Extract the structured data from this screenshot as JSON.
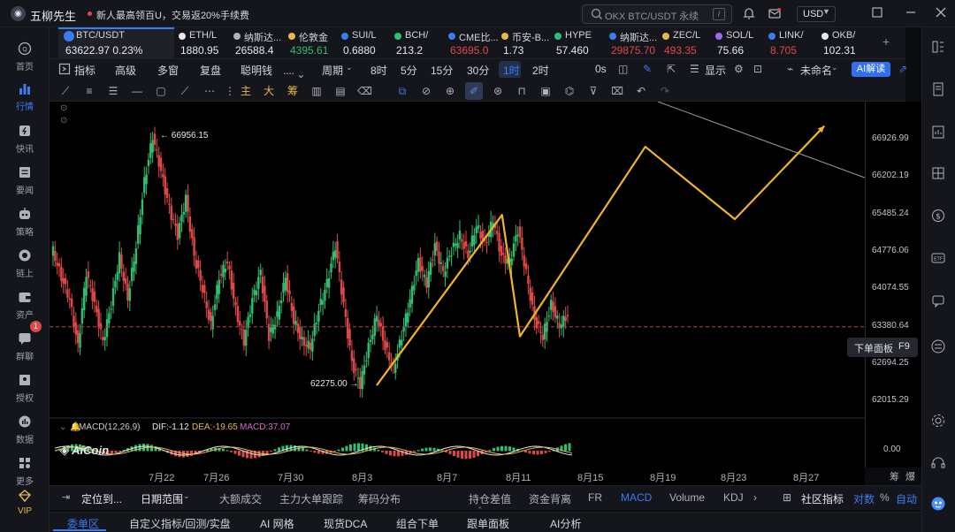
{
  "app": {
    "name": "五柳先生",
    "notice": "新人最高领百U，交易返20%手续费",
    "search_placeholder": "OKX BTC/USDT 永续",
    "search_key": "/",
    "currency": "USD"
  },
  "nav": [
    {
      "label": "首页",
      "icon": "home-icon"
    },
    {
      "label": "行情",
      "icon": "market-chart-icon",
      "active": true
    },
    {
      "label": "快讯",
      "icon": "news-flash-icon"
    },
    {
      "label": "要闻",
      "icon": "headline-icon"
    },
    {
      "label": "策略",
      "icon": "robot-icon"
    },
    {
      "label": "链上",
      "icon": "onchain-icon"
    },
    {
      "label": "资产",
      "icon": "wallet-icon"
    },
    {
      "label": "群聊",
      "icon": "chat-icon",
      "badge": "1"
    },
    {
      "label": "授权",
      "icon": "auth-icon"
    },
    {
      "label": "数据",
      "icon": "data-icon"
    },
    {
      "label": "更多",
      "icon": "more-icon"
    },
    {
      "label": "VIP",
      "icon": "vip-diamond-icon"
    }
  ],
  "tickers": [
    {
      "name": "BTC/USDT",
      "price": "63622.97",
      "change": "0.23%",
      "color": "white",
      "active": true
    },
    {
      "name": "ETH/L",
      "price": "1880.95",
      "color": "white"
    },
    {
      "name": "纳斯达...",
      "price": "26588.4",
      "color": "white"
    },
    {
      "name": "伦敦金",
      "price": "4395.61",
      "color": "green"
    },
    {
      "name": "SUI/L",
      "price": "0.6880",
      "color": "white"
    },
    {
      "name": "BCH/",
      "price": "213.2",
      "color": "white"
    },
    {
      "name": "CME比...",
      "price": "63695.0",
      "color": "red"
    },
    {
      "name": "币安-B...",
      "price": "1.73",
      "color": "white"
    },
    {
      "name": "HYPE",
      "price": "57.460",
      "color": "white"
    },
    {
      "name": "纳斯达...",
      "price": "29875.70",
      "color": "red"
    },
    {
      "name": "ZEC/L",
      "price": "493.35",
      "color": "red"
    },
    {
      "name": "SOL/L",
      "price": "75.66",
      "color": "white"
    },
    {
      "name": "LINK/",
      "price": "8.705",
      "color": "red"
    },
    {
      "name": "OKB/",
      "price": "102.31",
      "color": "white"
    }
  ],
  "toolbar": {
    "indicators": "指标",
    "advanced": "高级",
    "multi_window": "多窗",
    "replay": "复盘",
    "smart_money": "聪明钱",
    "period": "周期",
    "periods": [
      "8时",
      "5分",
      "15分",
      "30分",
      "1时",
      "2时"
    ],
    "period_selected": "1时",
    "zero_s": "0s",
    "display": "显示",
    "unnamed": "未命名",
    "ai_button": "AI解读"
  },
  "draw_tools": {
    "main": "主",
    "large": "大",
    "chips": "筹"
  },
  "chart_data": {
    "type": "line",
    "symbol": "BTC/USDT",
    "price_axis": [
      "66926.99",
      "66202.19",
      "65485.24",
      "64776.06",
      "64074.55",
      "63380.64",
      "62694.25",
      "62015.29"
    ],
    "date_axis": [
      "7月22",
      "7月26",
      "7月30",
      "8月3",
      "8月7",
      "8月11",
      "8月15",
      "8月19",
      "8月23",
      "8月27"
    ],
    "high_label": "66956.15",
    "low_label": "62275.00",
    "current_price_level": 63380.64,
    "series": [
      {
        "values": [
          64800,
          64300,
          63900,
          63000,
          64400,
          63800,
          63100,
          63800,
          64700,
          63900,
          64900,
          66100,
          66956,
          66300,
          65600,
          65100,
          65800,
          64700,
          64100,
          63400,
          64300,
          64600,
          63700,
          63100,
          63900,
          64400,
          63200,
          63600,
          64300,
          63500,
          63100,
          63000,
          63700,
          64200,
          64900,
          63800,
          62700,
          62300,
          63000,
          63600,
          63000,
          62600,
          63200,
          63900,
          64600,
          64200,
          64900,
          64400,
          64800,
          65100,
          64700,
          65300,
          64900,
          65400,
          64700,
          64600,
          65200,
          64400,
          63500,
          63200,
          63800,
          63400,
          63600
        ]
      }
    ],
    "projection": {
      "color": "#f0b429",
      "points": [
        {
          "date": "8月3",
          "price": 62280
        },
        {
          "date": "8月10",
          "price": 65480
        },
        {
          "date": "8月11",
          "price": 63200
        },
        {
          "date": "8月18",
          "price": 66760
        },
        {
          "date": "8月23",
          "price": 65400
        },
        {
          "date": "8月28",
          "price": 67150
        }
      ]
    },
    "macd": {
      "label": "MACD(12,26,9)",
      "dif": "DIF:-1.12",
      "dea": "DEA:-19.65",
      "macd": "MACD:37.07",
      "axis_zero": "0.00"
    }
  },
  "side_labels": {
    "chips": "筹",
    "burst": "爆"
  },
  "order_panel": {
    "label": "下单面板",
    "key": "F9"
  },
  "indicator_bar": {
    "locate": "定位到...",
    "date_range": "日期范围",
    "items": [
      "大额成交",
      "主力大单跟踪",
      "筹码分布",
      "持仓差值",
      "资金背离",
      "FR",
      "MACD",
      "Volume",
      "KDJ"
    ],
    "selected": "MACD",
    "community": "社区指标",
    "log": "对数",
    "percent": "%",
    "auto": "自动"
  },
  "bottom_tabs": [
    "委单区",
    "自定义指标/回测/实盘",
    "AI 网格",
    "现货DCA",
    "组合下单",
    "跟单面板",
    "AI分析"
  ],
  "watermark": "AiCoin"
}
